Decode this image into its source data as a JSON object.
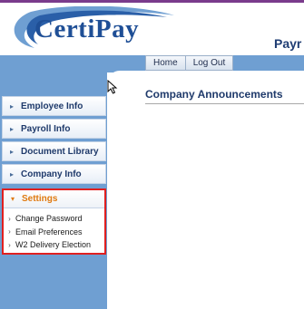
{
  "brand": {
    "name": "CertiPay",
    "header_text": "Payr"
  },
  "colors": {
    "brand_blue": "#1f4f96",
    "sidebar_blue": "#6f9fd2",
    "highlight_red": "#e02020",
    "settings_orange": "#e07a10"
  },
  "topnav": {
    "items": [
      {
        "label": "Home"
      },
      {
        "label": "Log Out"
      }
    ]
  },
  "main": {
    "section_title": "Company Announcements"
  },
  "sidebar": {
    "items": [
      {
        "label": "Employee Info",
        "icon": "chevron-right-icon"
      },
      {
        "label": "Payroll Info",
        "icon": "chevron-right-icon"
      },
      {
        "label": "Document Library",
        "icon": "chevron-right-icon"
      },
      {
        "label": "Company Info",
        "icon": "chevron-right-icon"
      }
    ],
    "settings": {
      "label": "Settings",
      "icon": "chevron-down-icon",
      "expanded": true,
      "subitems": [
        {
          "label": "Change Password"
        },
        {
          "label": "Email Preferences"
        },
        {
          "label": "W2 Delivery Election"
        }
      ]
    }
  }
}
